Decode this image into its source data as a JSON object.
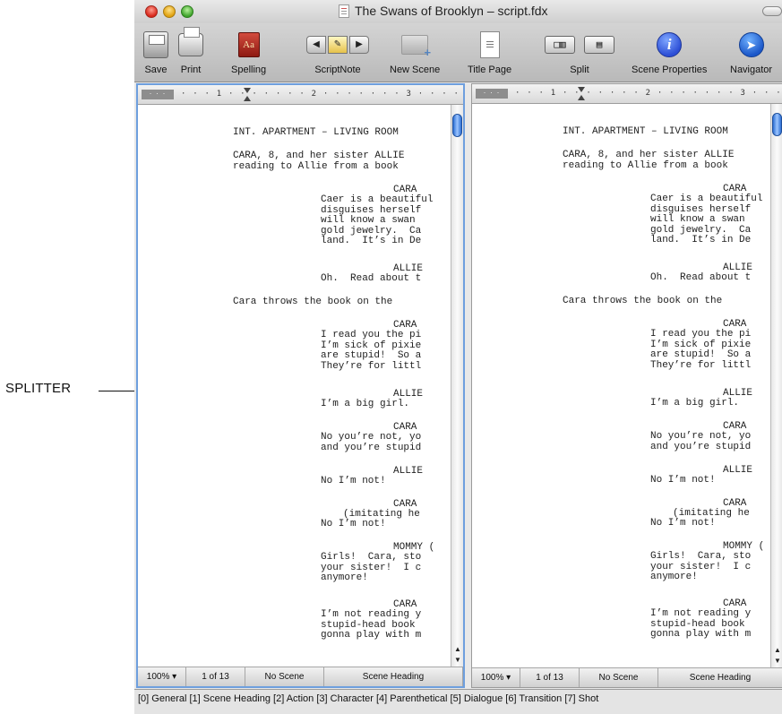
{
  "callout": {
    "label": "SPLITTER"
  },
  "window": {
    "title": "The Swans of Brooklyn – script.fdx"
  },
  "toolbar": {
    "save": "Save",
    "print": "Print",
    "spelling": "Spelling",
    "scriptnote": "ScriptNote",
    "new_scene": "New Scene",
    "title_page": "Title Page",
    "split": "Split",
    "scene_properties": "Scene Properties",
    "navigator": "Navigator",
    "spelling_glyph": "Aa",
    "info_glyph": "i"
  },
  "ruler": {
    "margin": "· · ·",
    "marks": "· · · 1 · · · · · · · 2 · · · · · · · 3 · · · · · · · 4 · · ·"
  },
  "script_lines": [
    "INT. APARTMENT – LIVING ROOM",
    "CARA, 8, and her sister ALLIE",
    "reading to Allie from a book",
    "CARA",
    "Caer is a beautiful",
    "disguises herself",
    "will know a swan",
    "gold jewelry.  Ca",
    "land.  It’s in De",
    "ALLIE",
    "Oh.  Read about t",
    "Cara throws the book on the",
    "CARA",
    "I read you the pi",
    "I’m sick of pixie",
    "are stupid!  So a",
    "They’re for littl",
    "ALLIE",
    "I’m a big girl.",
    "CARA",
    "No you’re not, yo",
    "and you’re stupid",
    "ALLIE",
    "No I’m not!",
    "CARA",
    "(imitating he",
    "No I’m not!",
    "MOMMY (",
    "Girls!  Cara, sto",
    "your sister!  I c",
    "anymore!",
    "CARA",
    "I’m not reading y",
    "stupid-head book",
    "gonna play with m"
  ],
  "pane_status": {
    "zoom": "100%",
    "page": "1 of 13",
    "scene": "No Scene",
    "element": "Scene Heading"
  },
  "bottom_status": "[0] General [1] Scene Heading [2] Action [3] Character [4] Parenthetical [5] Dialogue [6] Transition [7] Shot"
}
